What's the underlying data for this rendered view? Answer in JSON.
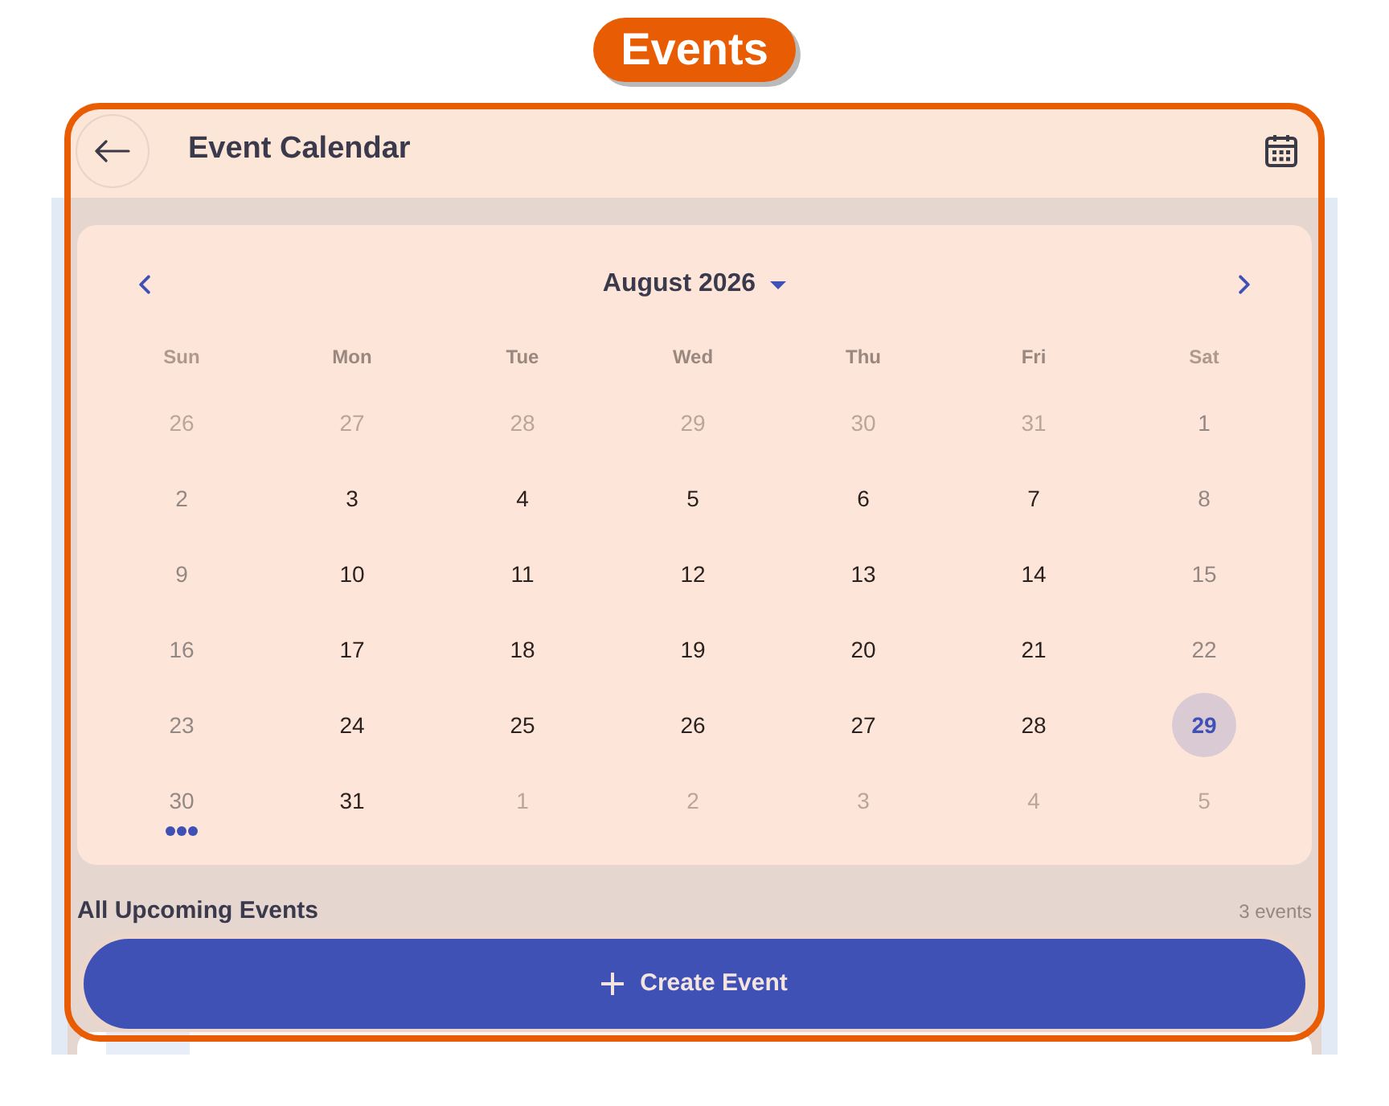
{
  "badge": {
    "text": "Events"
  },
  "header": {
    "title": "Event Calendar"
  },
  "calendar": {
    "month": "August 2026",
    "weekdays": [
      "Sun",
      "Mon",
      "Tue",
      "Wed",
      "Thu",
      "Fri",
      "Sat"
    ],
    "days": [
      {
        "label": "26",
        "kind": "outside",
        "selected": false,
        "has_events": false
      },
      {
        "label": "27",
        "kind": "outside",
        "selected": false,
        "has_events": false
      },
      {
        "label": "28",
        "kind": "outside",
        "selected": false,
        "has_events": false
      },
      {
        "label": "29",
        "kind": "outside",
        "selected": false,
        "has_events": false
      },
      {
        "label": "30",
        "kind": "outside",
        "selected": false,
        "has_events": false
      },
      {
        "label": "31",
        "kind": "outside",
        "selected": false,
        "has_events": false
      },
      {
        "label": "1",
        "kind": "current",
        "selected": false,
        "has_events": false
      },
      {
        "label": "2",
        "kind": "current",
        "selected": false,
        "has_events": false
      },
      {
        "label": "3",
        "kind": "current",
        "selected": false,
        "has_events": false
      },
      {
        "label": "4",
        "kind": "current",
        "selected": false,
        "has_events": false
      },
      {
        "label": "5",
        "kind": "current",
        "selected": false,
        "has_events": false
      },
      {
        "label": "6",
        "kind": "current",
        "selected": false,
        "has_events": false
      },
      {
        "label": "7",
        "kind": "current",
        "selected": false,
        "has_events": false
      },
      {
        "label": "8",
        "kind": "current",
        "selected": false,
        "has_events": false
      },
      {
        "label": "9",
        "kind": "current",
        "selected": false,
        "has_events": false
      },
      {
        "label": "10",
        "kind": "current",
        "selected": false,
        "has_events": false
      },
      {
        "label": "11",
        "kind": "current",
        "selected": false,
        "has_events": false
      },
      {
        "label": "12",
        "kind": "current",
        "selected": false,
        "has_events": false
      },
      {
        "label": "13",
        "kind": "current",
        "selected": false,
        "has_events": false
      },
      {
        "label": "14",
        "kind": "current",
        "selected": false,
        "has_events": false
      },
      {
        "label": "15",
        "kind": "current",
        "selected": false,
        "has_events": false
      },
      {
        "label": "16",
        "kind": "current",
        "selected": false,
        "has_events": false
      },
      {
        "label": "17",
        "kind": "current",
        "selected": false,
        "has_events": false
      },
      {
        "label": "18",
        "kind": "current",
        "selected": false,
        "has_events": false
      },
      {
        "label": "19",
        "kind": "current",
        "selected": false,
        "has_events": false
      },
      {
        "label": "20",
        "kind": "current",
        "selected": false,
        "has_events": false
      },
      {
        "label": "21",
        "kind": "current",
        "selected": false,
        "has_events": false
      },
      {
        "label": "22",
        "kind": "current",
        "selected": false,
        "has_events": false
      },
      {
        "label": "23",
        "kind": "current",
        "selected": false,
        "has_events": false
      },
      {
        "label": "24",
        "kind": "current",
        "selected": false,
        "has_events": false
      },
      {
        "label": "25",
        "kind": "current",
        "selected": false,
        "has_events": false
      },
      {
        "label": "26",
        "kind": "current",
        "selected": false,
        "has_events": false
      },
      {
        "label": "27",
        "kind": "current",
        "selected": false,
        "has_events": false
      },
      {
        "label": "28",
        "kind": "current",
        "selected": false,
        "has_events": false
      },
      {
        "label": "29",
        "kind": "current",
        "selected": true,
        "has_events": false
      },
      {
        "label": "30",
        "kind": "current",
        "selected": false,
        "has_events": true
      },
      {
        "label": "31",
        "kind": "current",
        "selected": false,
        "has_events": false
      },
      {
        "label": "1",
        "kind": "outside",
        "selected": false,
        "has_events": false
      },
      {
        "label": "2",
        "kind": "outside",
        "selected": false,
        "has_events": false
      },
      {
        "label": "3",
        "kind": "outside",
        "selected": false,
        "has_events": false
      },
      {
        "label": "4",
        "kind": "outside",
        "selected": false,
        "has_events": false
      },
      {
        "label": "5",
        "kind": "outside",
        "selected": false,
        "has_events": false
      }
    ]
  },
  "upcoming": {
    "title": "All Upcoming Events",
    "count": "3 events"
  },
  "create_button": {
    "label": "Create Event"
  }
}
